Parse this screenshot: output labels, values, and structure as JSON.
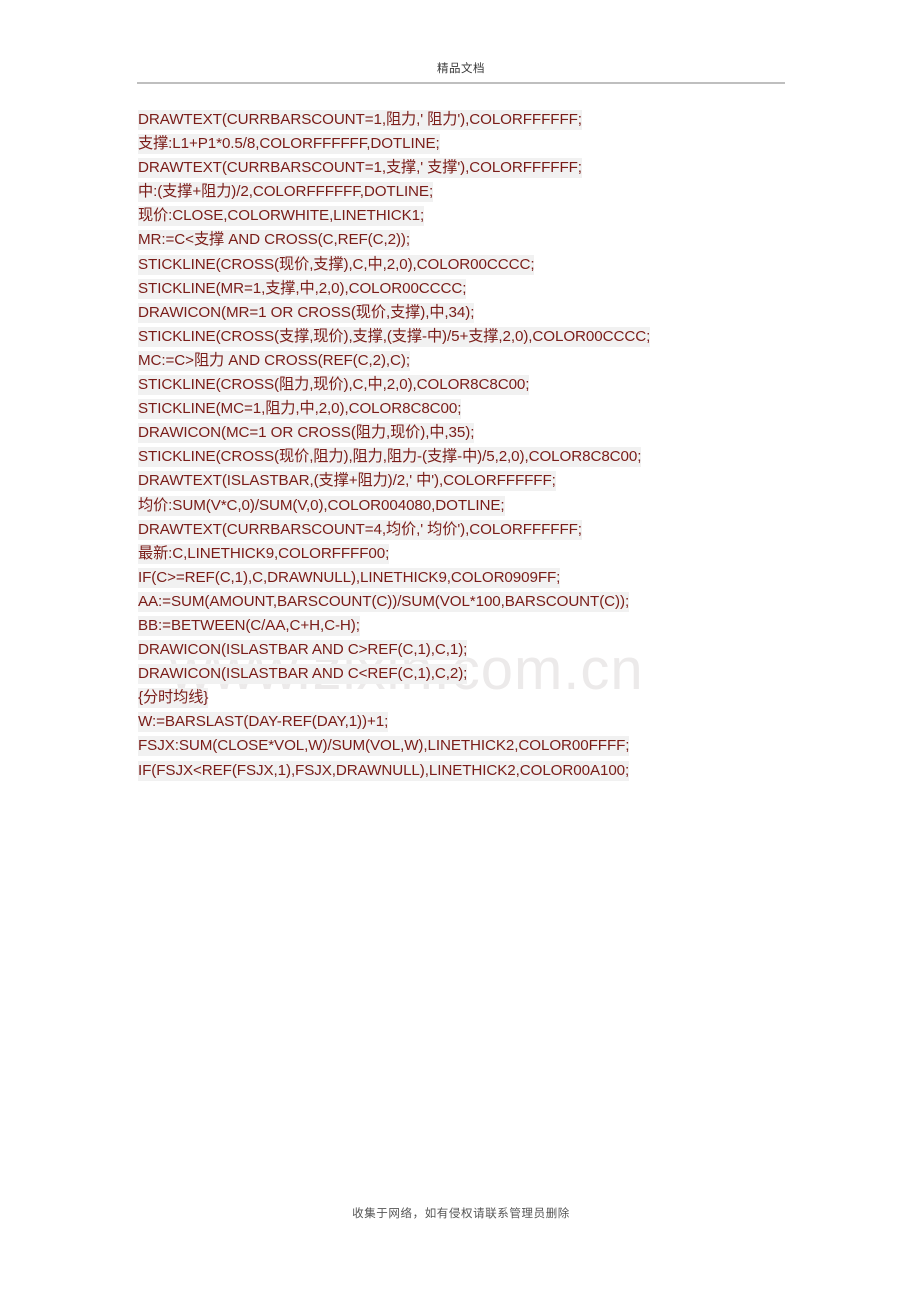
{
  "document": {
    "header": {
      "title": "精品文档"
    },
    "watermark": "www.zixin.com.cn",
    "footer": {
      "text": "收集于网络，如有侵权请联系管理员删除"
    },
    "colors": {
      "code_text": "#7a1c18",
      "highlight_background": "#f1f1f1",
      "header_text": "#3a3a3a",
      "rule": "#bfbfbf",
      "watermark": "#eceaea",
      "footer_text": "#555555",
      "page_background": "#ffffff"
    },
    "code_lines": [
      "DRAWTEXT(CURRBARSCOUNT=1,阻力,' 阻力'),COLORFFFFFF;",
      "支撑:L1+P1*0.5/8,COLORFFFFFF,DOTLINE;",
      "DRAWTEXT(CURRBARSCOUNT=1,支撑,' 支撑'),COLORFFFFFF;",
      "中:(支撑+阻力)/2,COLORFFFFFF,DOTLINE;",
      "现价:CLOSE,COLORWHITE,LINETHICK1;",
      "MR:=C<支撑 AND CROSS(C,REF(C,2));",
      "STICKLINE(CROSS(现价,支撑),C,中,2,0),COLOR00CCCC;",
      "STICKLINE(MR=1,支撑,中,2,0),COLOR00CCCC;",
      "DRAWICON(MR=1 OR CROSS(现价,支撑),中,34);",
      "STICKLINE(CROSS(支撑,现价),支撑,(支撑-中)/5+支撑,2,0),COLOR00CCCC;",
      "MC:=C>阻力 AND CROSS(REF(C,2),C);",
      "STICKLINE(CROSS(阻力,现价),C,中,2,0),COLOR8C8C00;",
      "STICKLINE(MC=1,阻力,中,2,0),COLOR8C8C00;",
      "DRAWICON(MC=1 OR CROSS(阻力,现价),中,35);",
      "STICKLINE(CROSS(现价,阻力),阻力,阻力-(支撑-中)/5,2,0),COLOR8C8C00;",
      "DRAWTEXT(ISLASTBAR,(支撑+阻力)/2,' 中'),COLORFFFFFF;",
      "均价:SUM(V*C,0)/SUM(V,0),COLOR004080,DOTLINE;",
      "DRAWTEXT(CURRBARSCOUNT=4,均价,' 均价'),COLORFFFFFF;",
      "最新:C,LINETHICK9,COLORFFFF00;",
      "IF(C>=REF(C,1),C,DRAWNULL),LINETHICK9,COLOR0909FF;",
      "AA:=SUM(AMOUNT,BARSCOUNT(C))/SUM(VOL*100,BARSCOUNT(C));",
      "BB:=BETWEEN(C/AA,C+H,C-H);",
      "DRAWICON(ISLASTBAR AND C>REF(C,1),C,1);",
      "DRAWICON(ISLASTBAR AND C<REF(C,1),C,2);",
      "{分时均线}",
      "W:=BARSLAST(DAY-REF(DAY,1))+1;",
      "FSJX:SUM(CLOSE*VOL,W)/SUM(VOL,W),LINETHICK2,COLOR00FFFF;",
      "IF(FSJX<REF(FSJX,1),FSJX,DRAWNULL),LINETHICK2,COLOR00A100;"
    ]
  }
}
